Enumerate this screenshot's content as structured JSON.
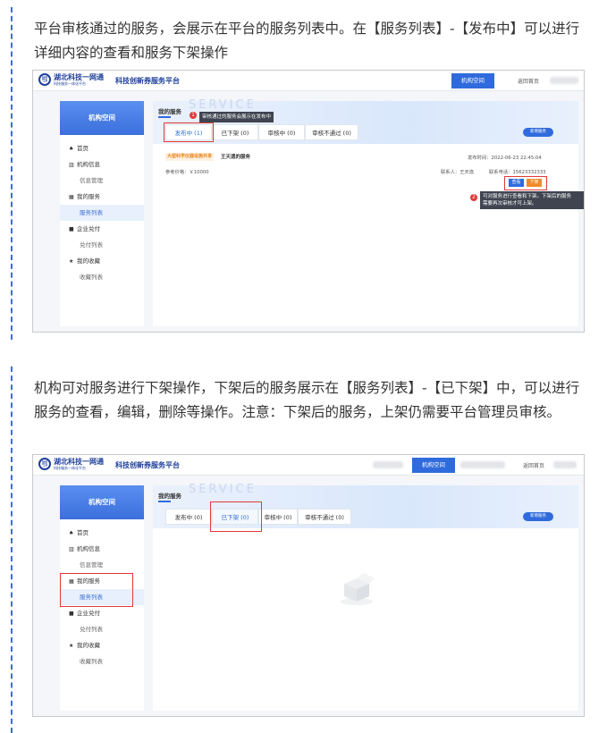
{
  "paragraphs": {
    "p1": "平台审核通过的服务，会展示在平台的服务列表中。在【服务列表】-【发布中】可以进行详细内容的查看和服务下架操作",
    "p2": "机构可对服务进行下架操作，下架后的服务展示在【服务列表】-【已下架】中，可以进行服务的查看，编辑，删除等操作。注意：下架后的服务，上架仍需要平台管理员审核。"
  },
  "header": {
    "logo_mark": "鄂",
    "logo_main": "湖北科技一网通",
    "logo_sub": "科技服务一体化平台",
    "site_title": "科技创新券服务平台",
    "org_space": "机构空间",
    "home_link": "返回首页"
  },
  "sidebar": {
    "title": "机构空间",
    "items": [
      {
        "label": "首页",
        "icon": "home-icon",
        "glyph": "♠"
      },
      {
        "label": "机构信息",
        "icon": "chart-icon",
        "glyph": "▥"
      },
      {
        "label": "信息管理"
      },
      {
        "label": "我的服务",
        "icon": "grid-icon",
        "glyph": "▦"
      },
      {
        "label": "服务列表"
      },
      {
        "label": "企业兑付",
        "icon": "square-icon",
        "glyph": "■"
      },
      {
        "label": "兑付列表"
      },
      {
        "label": "我的收藏",
        "icon": "star-icon",
        "glyph": "★"
      },
      {
        "label": "收藏列表"
      }
    ]
  },
  "main": {
    "section_title": "我的服务",
    "hero_deco": "SERVICE",
    "new_service": "新增服务",
    "tabs1": [
      "发布中 (1)",
      "已下架 (0)",
      "审核中 (0)",
      "审核不通过 (0)"
    ],
    "tabs2": [
      "发布中 (0)",
      "已下架 (0)",
      "审核中 (0)",
      "审核不通过 (0)"
    ]
  },
  "annotations": {
    "n1": "1",
    "tip1": "审核通过的服务会展示在发布中",
    "n2": "2",
    "tip2_line1": "可对服务进行查看和下架。下架后的服务",
    "tip2_line2": "需要再次审核才可上架。"
  },
  "service": {
    "category": "大型科学仪器设施共享",
    "name": "王天遗的服务",
    "publish_time": "发布时间：2022-06-23 22:45:04",
    "price": "参考价格：￥10000",
    "contact": "联系人：王天逸",
    "phone": "联系电话：15623332333",
    "view_btn": "查看",
    "offline_btn": "下架"
  },
  "colors": {
    "accent": "#2f6bdc",
    "highlight": "#e03a3a",
    "orange": "#e8851f"
  }
}
